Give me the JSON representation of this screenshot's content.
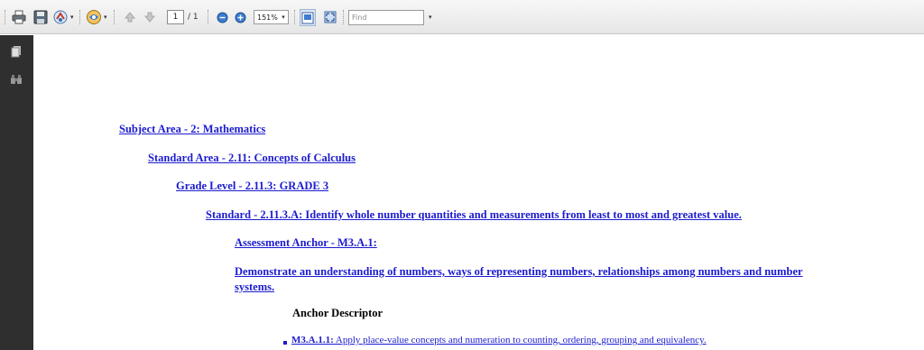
{
  "toolbar": {
    "buttons": [
      "print-icon",
      "save-icon",
      "share-icon",
      "collaborate-icon",
      "previous-page-icon",
      "next-page-icon",
      "zoom-out-icon",
      "zoom-in-icon",
      "fit-page-icon",
      "full-screen-icon"
    ],
    "page_current": "1",
    "page_total": "/ 1",
    "zoom_value": "151%",
    "find_placeholder": "Find"
  },
  "navpane": {
    "icons": [
      "pages-icon",
      "binoculars-icon"
    ]
  },
  "document": {
    "subject_area": "Subject Area - 2: Mathematics",
    "standard_area": "Standard Area - 2.11: Concepts of Calculus",
    "grade_level": "Grade Level - 2.11.3: GRADE 3",
    "standard": "Standard - 2.11.3.A: Identify whole number quantities and measurements from least to most and greatest value.",
    "assessment_anchor": "Assessment Anchor - M3.A.1:",
    "demonstrate": "Demonstrate an understanding of numbers, ways of representing numbers, relationships among numbers and number systems.",
    "anchor_descriptor": "Anchor Descriptor",
    "descriptor_item": {
      "code": "M3.A.1.1:",
      "text": " Apply place-value concepts and numeration to counting, ordering, grouping and equivalency."
    }
  },
  "colors": {
    "link": "#1c1ccf",
    "navpane": "#2f2f2f",
    "toolbar": "#ececec"
  }
}
